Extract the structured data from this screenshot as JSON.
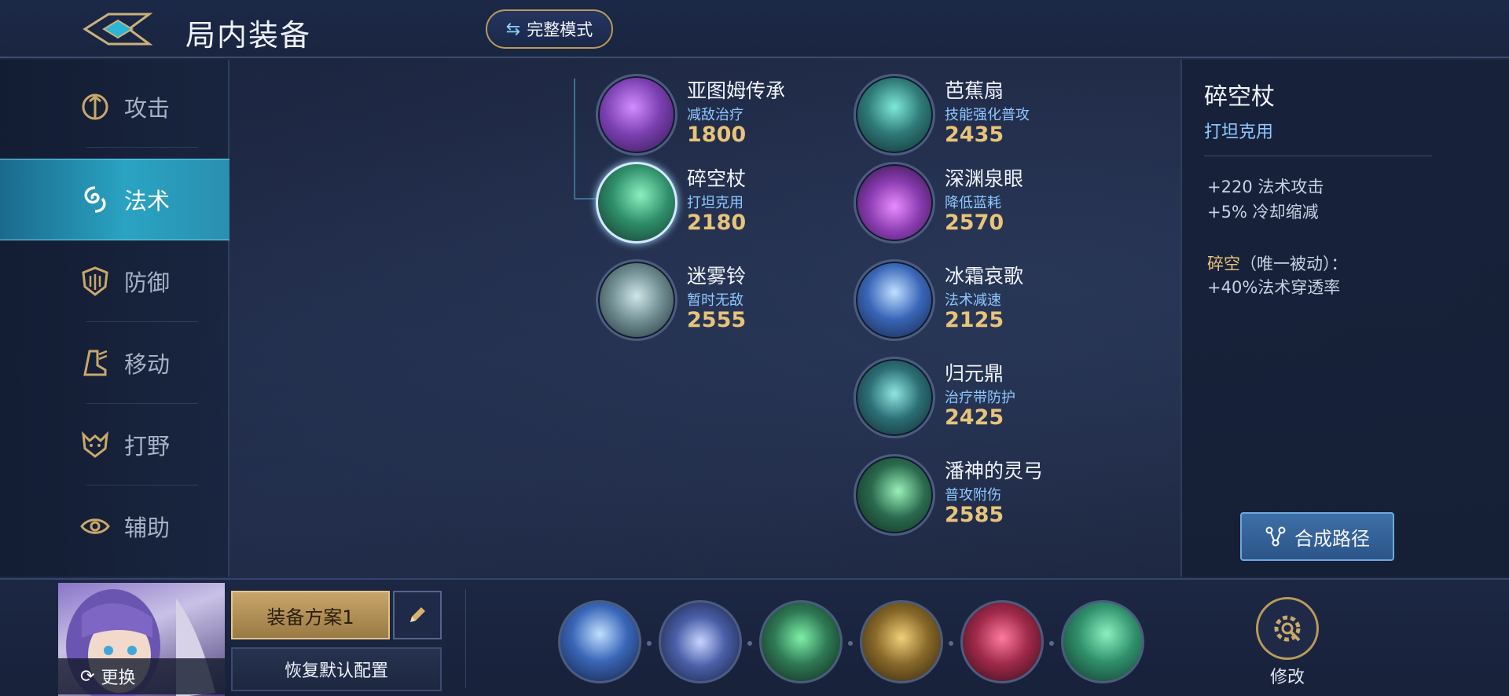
{
  "header": {
    "title": "局内装备",
    "mode_button": "完整模式"
  },
  "sidebar": {
    "items": [
      {
        "label": "攻击",
        "icon": "sword-icon",
        "active": false
      },
      {
        "label": "法术",
        "icon": "magic-swirl-icon",
        "active": true
      },
      {
        "label": "防御",
        "icon": "shield-icon",
        "active": false
      },
      {
        "label": "移动",
        "icon": "boot-icon",
        "active": false
      },
      {
        "label": "打野",
        "icon": "jungle-beast-icon",
        "active": false
      },
      {
        "label": "辅助",
        "icon": "eye-icon",
        "active": false
      }
    ]
  },
  "items": {
    "left": [
      {
        "name": "亚图姆传承",
        "desc": "减敌治疗",
        "price": "1800",
        "icon": "purple-book-icon",
        "color": "#7a3fb0"
      },
      {
        "name": "碎空杖",
        "desc": "打坦克用",
        "price": "2180",
        "icon": "jade-staff-icon",
        "color": "#2f8f6a",
        "selected": true
      },
      {
        "name": "迷雾铃",
        "desc": "暂时无敌",
        "price": "2555",
        "icon": "silver-bell-icon",
        "color": "#6f8d92"
      }
    ],
    "right": [
      {
        "name": "芭蕉扇",
        "desc": "技能强化普攻",
        "price": "2435",
        "icon": "fan-icon",
        "color": "#2e7a78"
      },
      {
        "name": "深渊泉眼",
        "desc": "降低蓝耗",
        "price": "2570",
        "icon": "abyss-fountain-icon",
        "color": "#8a3cb0"
      },
      {
        "name": "冰霜哀歌",
        "desc": "法术减速",
        "price": "2125",
        "icon": "frost-shard-icon",
        "color": "#3a66b8"
      },
      {
        "name": "归元鼎",
        "desc": "治疗带防护",
        "price": "2425",
        "icon": "cauldron-icon",
        "color": "#2c6f76"
      },
      {
        "name": "潘神的灵弓",
        "desc": "普攻附伤",
        "price": "2585",
        "icon": "spirit-bow-icon",
        "color": "#2a6a4e"
      }
    ]
  },
  "detail": {
    "name": "碎空杖",
    "tag": "打坦克用",
    "stats": [
      "+220 法术攻击",
      "+5% 冷却缩减"
    ],
    "passive_name": "碎空",
    "passive_label": "（唯一被动）：",
    "passive_text": "+40%法术穿透率",
    "synth_button": "合成路径"
  },
  "bottom": {
    "change_label": "更换",
    "plan_label": "装备方案1",
    "reset_label": "恢复默认配置",
    "modify_label": "修改",
    "slots": [
      {
        "icon": "frost-shard-icon",
        "color": "#3a66b8"
      },
      {
        "icon": "mana-boots-icon",
        "color": "#4a5fa8"
      },
      {
        "icon": "emerald-orb-icon",
        "color": "#2f7a56"
      },
      {
        "icon": "golden-pharaoh-icon",
        "color": "#8a6a2a"
      },
      {
        "icon": "wizard-hat-icon",
        "color": "#a02a4a"
      },
      {
        "icon": "jade-staff-icon",
        "color": "#2f8f6a"
      }
    ]
  }
}
